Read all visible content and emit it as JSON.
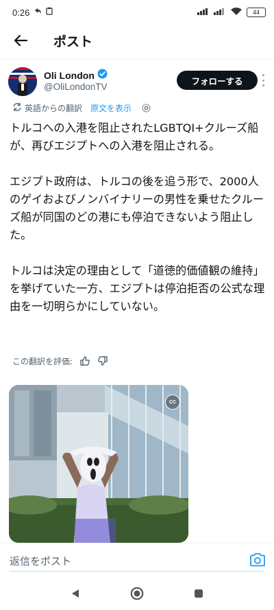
{
  "status_bar": {
    "time": "0:26",
    "battery": "44"
  },
  "header": {
    "title": "ポスト"
  },
  "author": {
    "name": "Oli London",
    "handle": "@OliLondonTV",
    "follow_label": "フォローする"
  },
  "translation": {
    "translated_from": "英語からの翻訳",
    "show_original": "原文を表示",
    "rate_label": "この翻訳を評価:"
  },
  "tweet": {
    "paragraphs": [
      "トルコへの入港を阻止されたLGBTQI+クルーズ船が、再びエジプトへの入港を阻止される。",
      "エジプト政府は、トルコの後を追う形で、2000人のゲイおよびノンバイナリーの男性を乗せたクルーズ船が同国のどの港にも停泊できないよう阻止した。",
      "トルコは決定の理由として「道徳的価値観の維持」を挙げていた一方、エジプトは停泊拒否の公式な理由を一切明らかにしていない。"
    ]
  },
  "media": {
    "cc_label": "CC"
  },
  "reply": {
    "placeholder": "返信をポスト"
  },
  "colors": {
    "accent": "#1d9bf0",
    "text": "#0f1419",
    "secondary": "#536471",
    "follow_bg": "#0f1419"
  },
  "icons": [
    "back-arrow-icon",
    "verified-badge-icon",
    "more-options-icon",
    "translate-icon",
    "gear-icon",
    "thumbs-up-icon",
    "thumbs-down-icon",
    "closed-captions-icon",
    "camera-icon",
    "nav-back-icon",
    "nav-home-icon",
    "nav-recents-icon",
    "signal-icon",
    "wifi-icon",
    "battery-icon"
  ]
}
